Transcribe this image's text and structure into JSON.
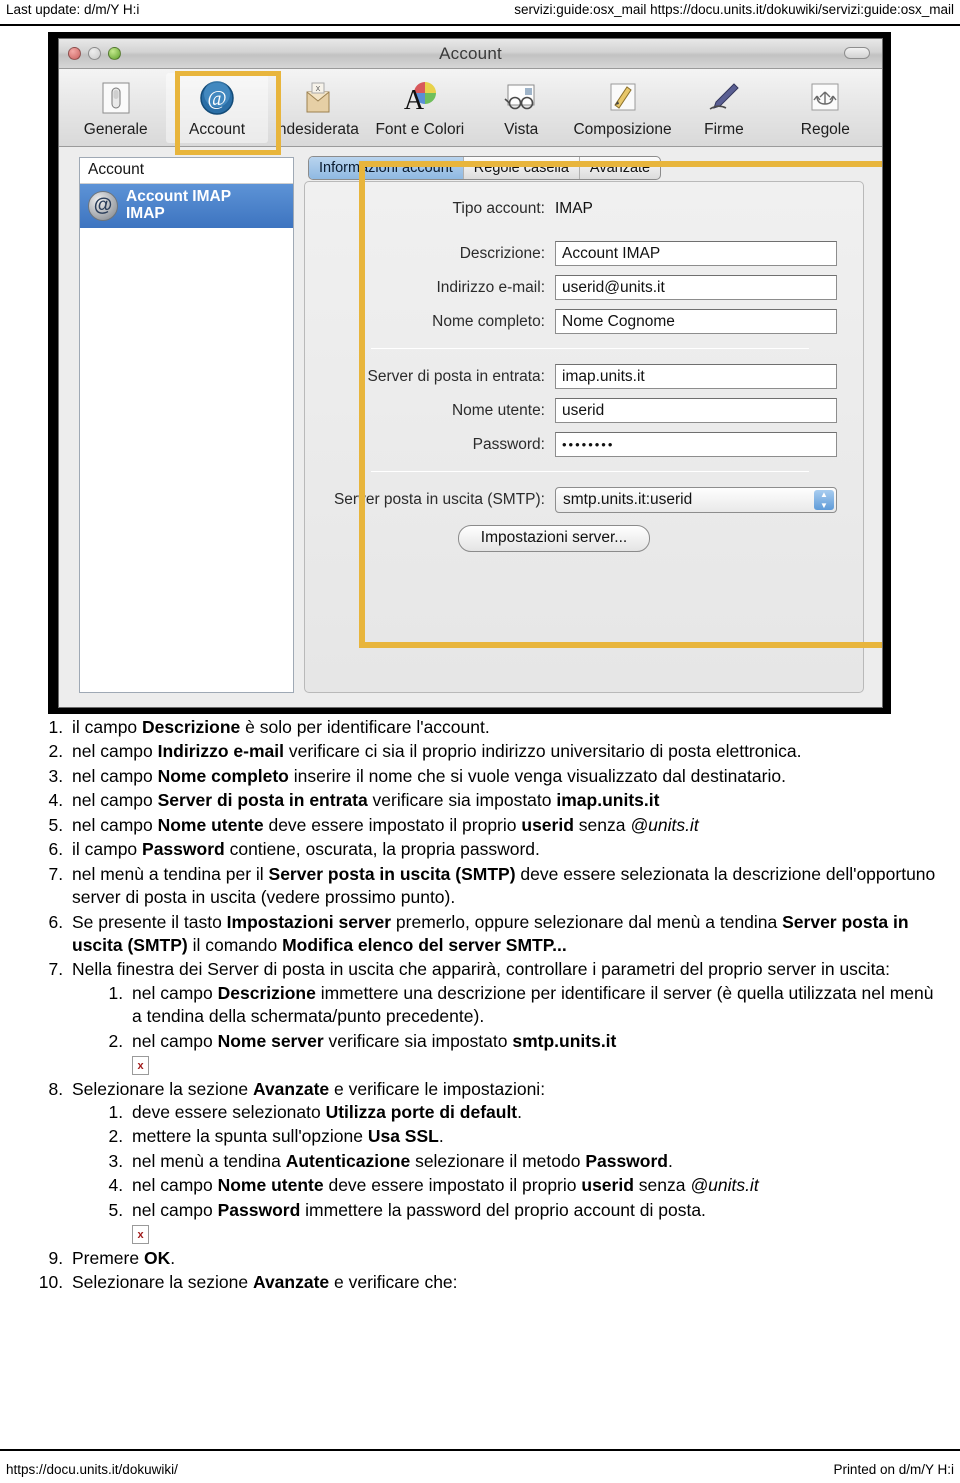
{
  "page": {
    "header_left": "Last update: d/m/Y H:i",
    "header_right": "servizi:guide:osx_mail https://docu.units.it/dokuwiki/servizi:guide:osx_mail",
    "footer_left": "https://docu.units.it/dokuwiki/",
    "footer_right": "Printed on d/m/Y H:i"
  },
  "screenshot": {
    "window_title": "Account",
    "toolbar": {
      "items": [
        {
          "label": "Generale",
          "icon": "switch-icon",
          "selected": false
        },
        {
          "label": "Account",
          "icon": "at-sign-icon",
          "selected": true
        },
        {
          "label": "ndesiderata",
          "icon": "junk-mail-icon",
          "selected": false
        },
        {
          "label": "Font e Colori",
          "icon": "font-color-icon",
          "selected": false
        },
        {
          "label": "Vista",
          "icon": "glasses-icon",
          "selected": false
        },
        {
          "label": "Composizione",
          "icon": "pencil-icon",
          "selected": false
        },
        {
          "label": "Firme",
          "icon": "fountain-pen-icon",
          "selected": false
        },
        {
          "label": "Regole",
          "icon": "rules-arrows-icon",
          "selected": false
        }
      ]
    },
    "sidebar": {
      "header": "Account",
      "account": {
        "name": "Account IMAP",
        "type": "IMAP",
        "icon": "globe-at-icon"
      }
    },
    "tabs": [
      {
        "label": "Informazioni account",
        "active": true
      },
      {
        "label": "Regole casella",
        "active": false
      },
      {
        "label": "Avanzate",
        "active": false
      }
    ],
    "form": {
      "account_type_label": "Tipo account:",
      "account_type_value": "IMAP",
      "descrizione_label": "Descrizione:",
      "descrizione_value": "Account IMAP",
      "email_label": "Indirizzo e-mail:",
      "email_value": "userid@units.it",
      "nome_completo_label": "Nome completo:",
      "nome_completo_value": "Nome Cognome",
      "incoming_label": "Server di posta in entrata:",
      "incoming_value": "imap.units.it",
      "username_label": "Nome utente:",
      "username_value": "userid",
      "password_label": "Password:",
      "password_value": "••••••••",
      "smtp_label": "Server posta in uscita (SMTP):",
      "smtp_value": "smtp.units.it:userid",
      "server_settings_button": "Impostazioni server..."
    },
    "highlight_color": "#e8b53c"
  },
  "instructions": {
    "list1": [
      {
        "parts": [
          {
            "t": "il campo "
          },
          {
            "t": "Descrizione",
            "b": true
          },
          {
            "t": " è solo per identificare l'account."
          }
        ]
      },
      {
        "parts": [
          {
            "t": "nel campo "
          },
          {
            "t": "Indirizzo e-mail",
            "b": true
          },
          {
            "t": " verificare ci sia il proprio indirizzo universitario di posta elettronica."
          }
        ]
      },
      {
        "parts": [
          {
            "t": "nel campo "
          },
          {
            "t": "Nome completo",
            "b": true
          },
          {
            "t": " inserire il nome che si vuole venga visualizzato dal destinatario."
          }
        ]
      },
      {
        "parts": [
          {
            "t": "nel campo "
          },
          {
            "t": "Server di posta in entrata",
            "b": true
          },
          {
            "t": " verificare sia impostato "
          },
          {
            "t": "imap.units.it",
            "b": true
          }
        ]
      },
      {
        "parts": [
          {
            "t": "nel campo "
          },
          {
            "t": "Nome utente",
            "b": true
          },
          {
            "t": " deve essere impostato il proprio "
          },
          {
            "t": "userid",
            "b": true
          },
          {
            "t": " senza "
          },
          {
            "t": "@units.it",
            "i": true
          }
        ]
      },
      {
        "parts": [
          {
            "t": "il campo "
          },
          {
            "t": "Password",
            "b": true
          },
          {
            "t": " contiene, oscurata, la propria password."
          }
        ]
      },
      {
        "parts": [
          {
            "t": "nel menù a tendina per il "
          },
          {
            "t": "Server posta in uscita (SMTP)",
            "b": true
          },
          {
            "t": " deve essere selezionata la descrizione dell'opportuno server di posta in uscita (vedere prossimo punto)."
          }
        ]
      }
    ],
    "list2_start": 6,
    "list2": [
      {
        "parts": [
          {
            "t": "Se presente il tasto "
          },
          {
            "t": "Impostazioni server",
            "b": true
          },
          {
            "t": " premerlo, oppure selezionare dal menù a tendina "
          },
          {
            "t": "Server posta in uscita (SMTP)",
            "b": true
          },
          {
            "t": " il comando "
          },
          {
            "t": "Modifica elenco del server SMTP...",
            "b": true
          }
        ],
        "sub": []
      },
      {
        "parts": [
          {
            "t": "Nella finestra dei Server di posta in uscita che apparirà, controllare i parametri del proprio server in uscita:"
          }
        ],
        "sub": [
          {
            "parts": [
              {
                "t": "nel campo "
              },
              {
                "t": "Descrizione",
                "b": true
              },
              {
                "t": " immettere una descrizione per identificare il server (è quella utilizzata nel menù a tendina della schermata/punto precedente)."
              }
            ]
          },
          {
            "parts": [
              {
                "t": "nel campo "
              },
              {
                "t": "Nome server",
                "b": true
              },
              {
                "t": " verificare sia impostato "
              },
              {
                "t": "smtp.units.it",
                "b": true
              }
            ],
            "broken_image": true
          }
        ]
      },
      {
        "parts": [
          {
            "t": "Selezionare la sezione "
          },
          {
            "t": "Avanzate",
            "b": true
          },
          {
            "t": " e verificare le impostazioni:"
          }
        ],
        "sub": [
          {
            "parts": [
              {
                "t": "deve essere selezionato "
              },
              {
                "t": "Utilizza porte di default",
                "b": true
              },
              {
                "t": "."
              }
            ]
          },
          {
            "parts": [
              {
                "t": "mettere la spunta sull'opzione "
              },
              {
                "t": "Usa SSL",
                "b": true
              },
              {
                "t": "."
              }
            ]
          },
          {
            "parts": [
              {
                "t": "nel menù a tendina "
              },
              {
                "t": "Autenticazione",
                "b": true
              },
              {
                "t": " selezionare il metodo "
              },
              {
                "t": "Password",
                "b": true
              },
              {
                "t": "."
              }
            ]
          },
          {
            "parts": [
              {
                "t": "nel campo "
              },
              {
                "t": "Nome utente",
                "b": true
              },
              {
                "t": " deve essere impostato il proprio "
              },
              {
                "t": "userid",
                "b": true
              },
              {
                "t": " senza "
              },
              {
                "t": "@units.it",
                "i": true
              }
            ]
          },
          {
            "parts": [
              {
                "t": "nel campo "
              },
              {
                "t": "Password",
                "b": true
              },
              {
                "t": " immettere la password del proprio account di posta."
              }
            ],
            "broken_image": true
          }
        ]
      },
      {
        "parts": [
          {
            "t": "Premere "
          },
          {
            "t": "OK",
            "b": true
          },
          {
            "t": "."
          }
        ],
        "sub": []
      },
      {
        "parts": [
          {
            "t": "Selezionare la sezione "
          },
          {
            "t": "Avanzate",
            "b": true
          },
          {
            "t": " e verificare che:"
          }
        ],
        "sub": []
      }
    ]
  }
}
